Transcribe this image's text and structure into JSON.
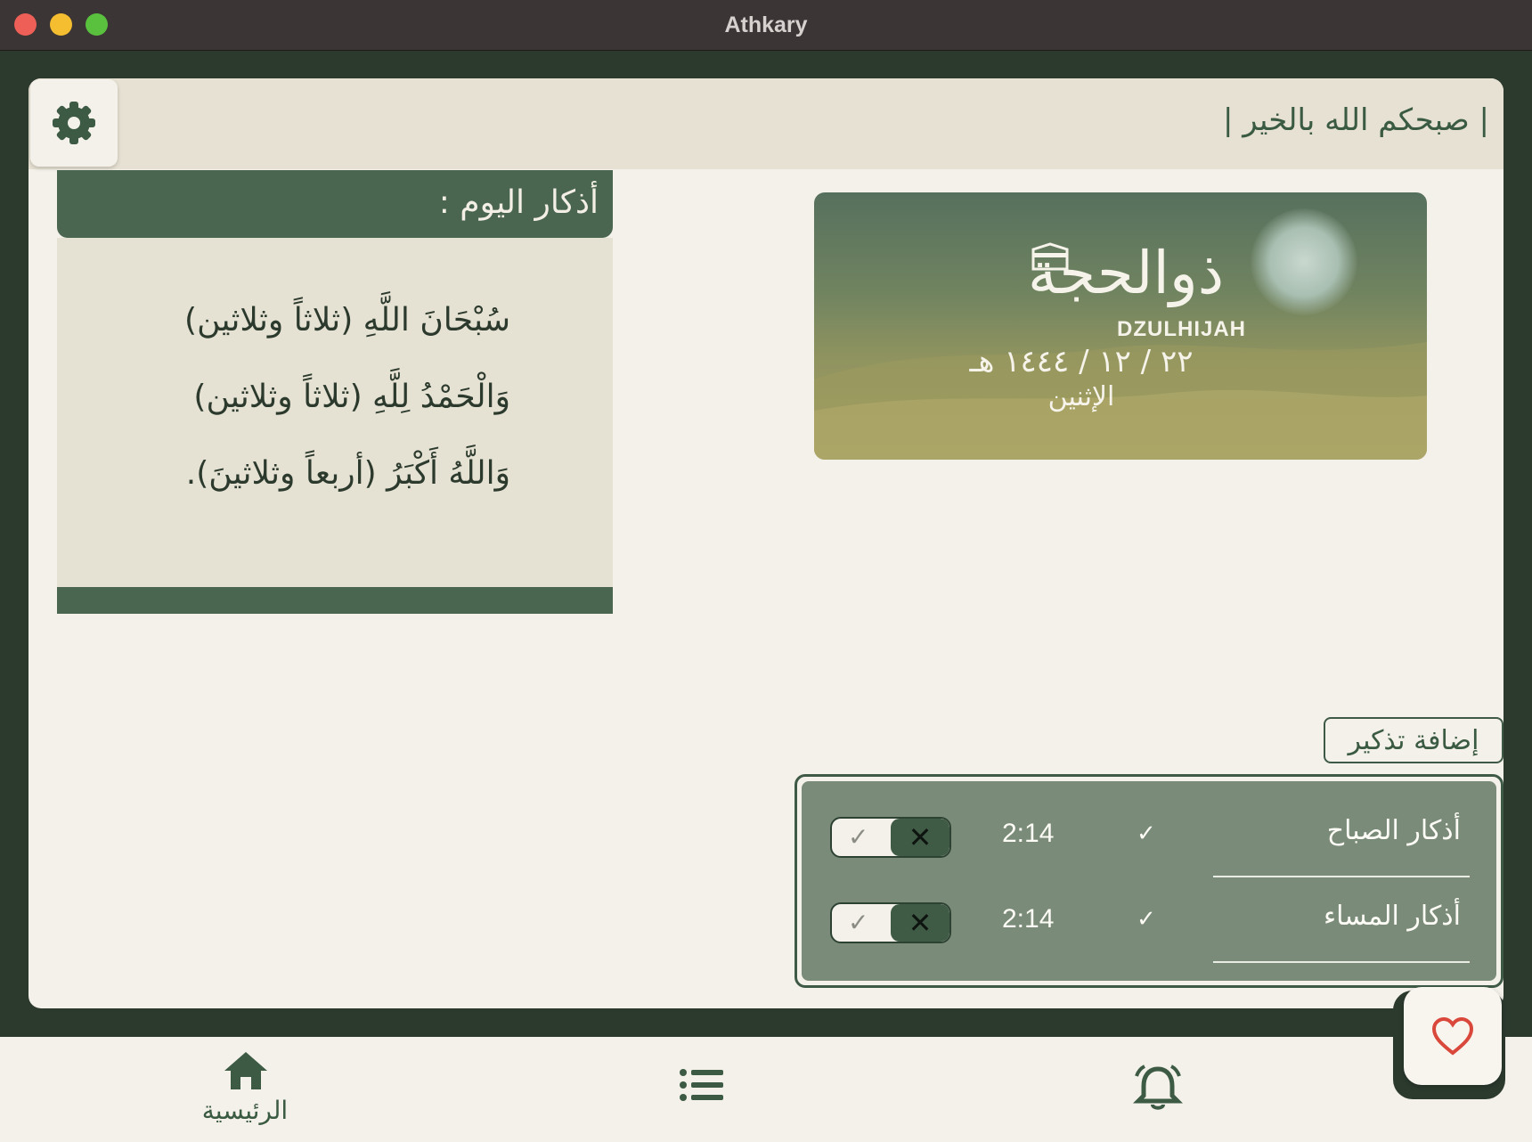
{
  "window": {
    "title": "Athkary"
  },
  "header": {
    "greeting": "| صبحكم الله بالخير |",
    "settings_icon": "gear-icon"
  },
  "daily_dhikr": {
    "title": "أذكار اليوم :",
    "lines": [
      "سُبْحَانَ اللَّهِ (ثلاثاً وثلاثين)",
      "وَالْحَمْدُ لِلَّهِ (ثلاثاً وثلاثين)",
      "وَاللَّهُ أَكْبَرُ (أربعاً وثلاثينَ)."
    ]
  },
  "date_banner": {
    "month_ar": "ذوالحجة",
    "month_en": "DZULHIJAH",
    "hijri_date": "٢٢ / ١٢ / ١٤٤٤ هـ",
    "weekday": "الإثنين"
  },
  "reminders": {
    "add_label": "إضافة تذكير",
    "items": [
      {
        "name": "أذكار الصباح",
        "time": "2:14",
        "check": "✓"
      },
      {
        "name": "أذكار المساء",
        "time": "2:14",
        "check": "✓"
      }
    ]
  },
  "nav": {
    "home_label": "الرئيسية",
    "home_icon": "home-icon",
    "list_icon": "list-icon",
    "bell_icon": "bell-icon",
    "favorite_icon": "heart-icon"
  },
  "colors": {
    "primary": "#4a6650",
    "frame": "#2c3a2e",
    "background": "#f4f0ea",
    "reminder_panel": "#7a8c79",
    "heart": "#d9483b"
  }
}
